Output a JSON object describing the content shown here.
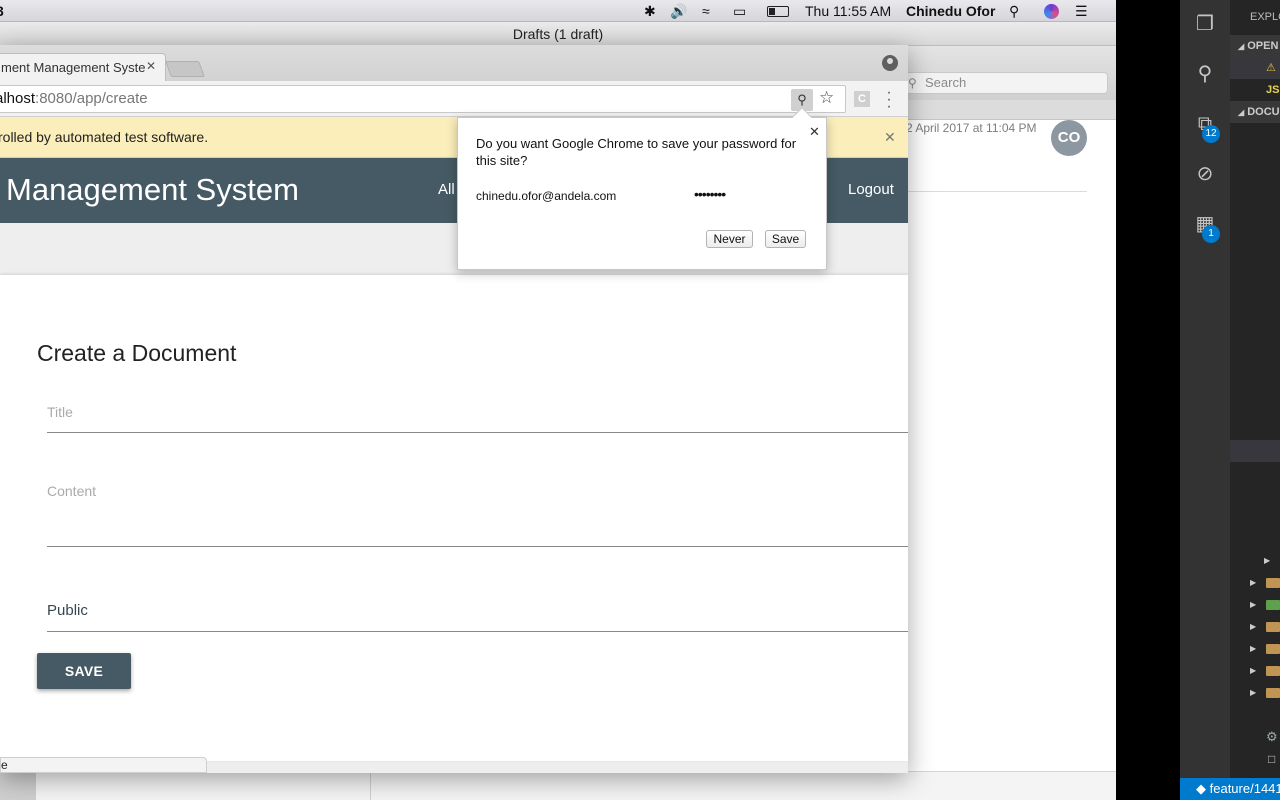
{
  "menubar": {
    "app_fragment": "3",
    "clock": "Thu 11:55 AM",
    "user": "Chinedu Ofor",
    "icons": [
      "bluetooth-icon",
      "volume-icon",
      "wifi-icon",
      "airplay-icon",
      "battery-icon",
      "spotlight-icon",
      "siri-icon",
      "notification-center-icon"
    ]
  },
  "mail": {
    "window_title": "Drafts (1 draft)",
    "search_placeholder": "Search",
    "message_date": "2 April 2017 at 11:04 PM",
    "avatar_initials": "CO"
  },
  "chrome": {
    "tab_title": "ment Management Syste",
    "url_host": "alhost",
    "url_path": ":8080/app/create",
    "ext_label": "C",
    "infobar_text": "rolled by automated test software.",
    "status_text": "e"
  },
  "app": {
    "title": "Management System",
    "nav_all": "All",
    "nav_logout": "Logout",
    "form_title": "Create a Document",
    "title_placeholder": "Title",
    "content_placeholder": "Content",
    "public_label": "Public",
    "save_label": "SAVE"
  },
  "password_prompt": {
    "question": "Do you want Google Chrome to save your password for this site?",
    "username": "chinedu.ofor@andela.com",
    "password_mask": "••••••••",
    "never_label": "Never",
    "save_label": "Save"
  },
  "vscode": {
    "explorer_title": "EXPLO",
    "open_editors": "OPEN",
    "file_js": "JS",
    "folder_section": "DOCU",
    "scm_badge": "12",
    "ext_badge": "1",
    "branch": "feature/1441"
  }
}
